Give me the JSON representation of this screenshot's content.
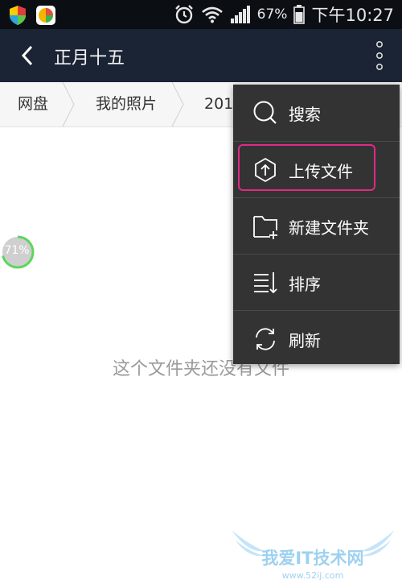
{
  "status_bar": {
    "battery": "67%",
    "time": "下午10:27"
  },
  "app_bar": {
    "title": "正月十五"
  },
  "breadcrumb": {
    "items": [
      "网盘",
      "我的照片",
      "201"
    ]
  },
  "content": {
    "empty_message": "这个文件夹还没有文件",
    "progress": {
      "label": "71%",
      "value": 71
    }
  },
  "menu": {
    "items": [
      {
        "label": "搜索",
        "icon": "search-icon"
      },
      {
        "label": "上传文件",
        "icon": "upload-icon"
      },
      {
        "label": "新建文件夹",
        "icon": "new-folder-icon"
      },
      {
        "label": "排序",
        "icon": "sort-icon"
      },
      {
        "label": "刷新",
        "icon": "refresh-icon"
      }
    ]
  },
  "watermark": {
    "brand": "我爱IT技术网",
    "url": "www.52ij.com"
  },
  "colors": {
    "status_bar_bg": "#0b0f14",
    "app_bar_bg": "#1b2434",
    "menu_bg": "#333333",
    "highlight": "#e02a86",
    "progress_ring": "#5cd65c"
  }
}
